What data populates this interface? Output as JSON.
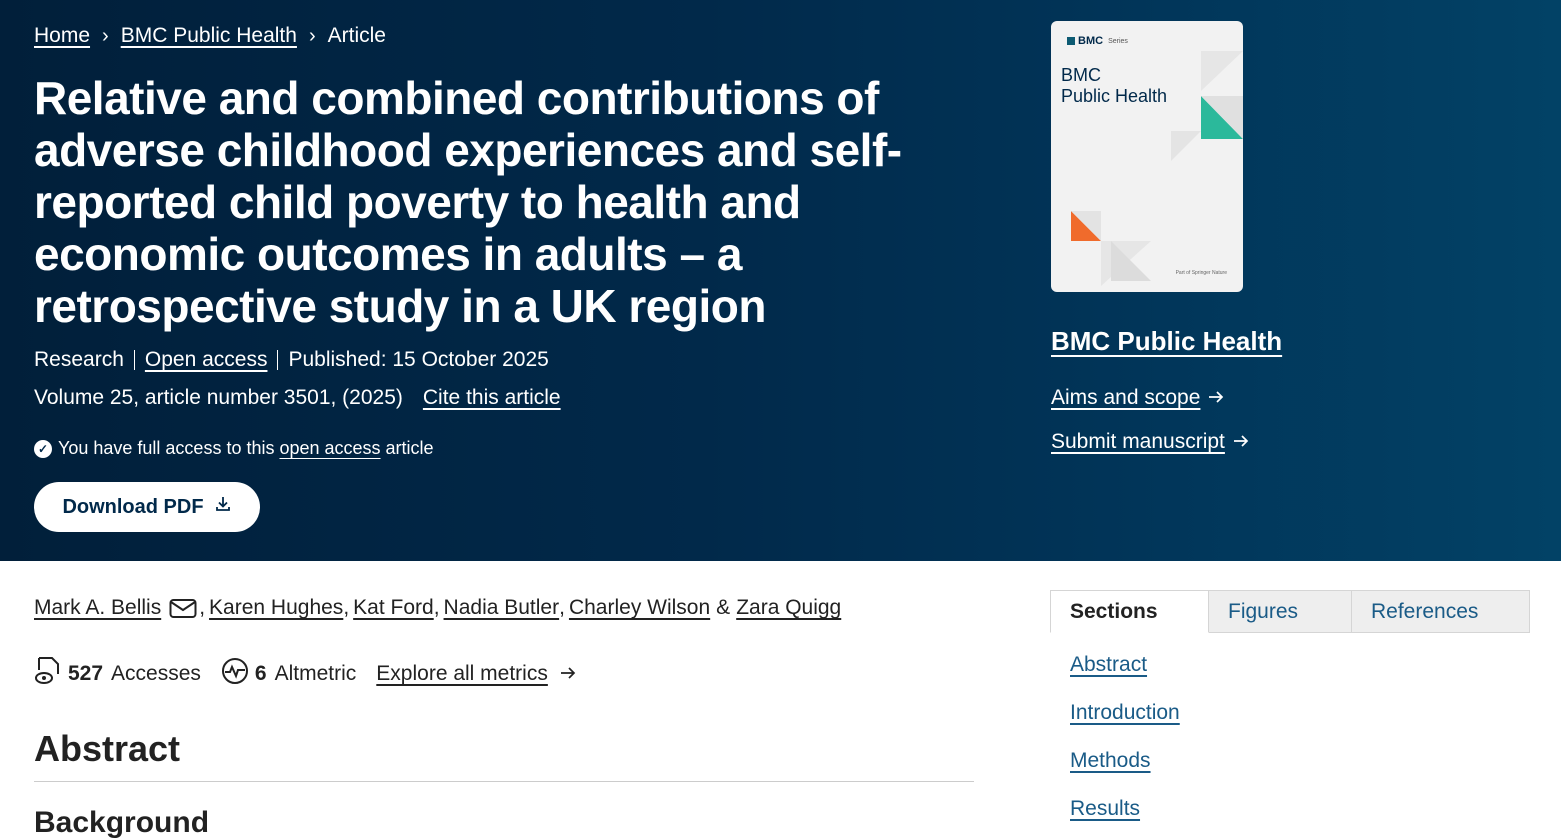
{
  "breadcrumb": {
    "home": "Home",
    "journal": "BMC Public Health",
    "current": "Article"
  },
  "article": {
    "title": "Relative and combined contributions of adverse childhood experiences and self-reported child poverty to health and economic outcomes in adults – a retrospective study in a UK region",
    "type": "Research",
    "access": "Open access",
    "published": "Published: 15 October 2025",
    "volume": "Volume 25, article number 3501, (2025)",
    "cite": "Cite this article",
    "access_note_prefix": "You have full access to this",
    "access_note_link": "open access",
    "access_note_suffix": "article",
    "download_label": "Download PDF"
  },
  "cover": {
    "series": "BMC",
    "series_suffix": "Series",
    "title_line1": "BMC",
    "title_line2": "Public Health",
    "footer": "Part of Springer Nature"
  },
  "journal": {
    "name": "BMC Public Health",
    "aims": "Aims and scope",
    "submit": "Submit manuscript"
  },
  "authors": {
    "names": [
      "Mark A. Bellis",
      "Karen Hughes",
      "Kat Ford",
      "Nadia Butler",
      "Charley Wilson",
      "Zara Quigg"
    ],
    "sep": ",",
    "amp": "&"
  },
  "metrics": {
    "accesses_count": "527",
    "accesses_label": "Accesses",
    "altmetric_count": "6",
    "altmetric_label": "Altmetric",
    "explore": "Explore all metrics"
  },
  "content": {
    "abstract_heading": "Abstract",
    "background_heading": "Background"
  },
  "nav": {
    "tabs": [
      "Sections",
      "Figures",
      "References"
    ],
    "sections": [
      "Abstract",
      "Introduction",
      "Methods",
      "Results"
    ]
  },
  "colors": {
    "hero_bg": "#01294a",
    "link_blue": "#1a5b87",
    "teal_accent": "#2bb99b",
    "orange_accent": "#f06b2c"
  },
  "icons": [
    "chevron-right-icon",
    "check-circle-icon",
    "download-icon",
    "arrow-right-icon",
    "mail-icon",
    "accesses-icon",
    "altmetric-icon"
  ]
}
